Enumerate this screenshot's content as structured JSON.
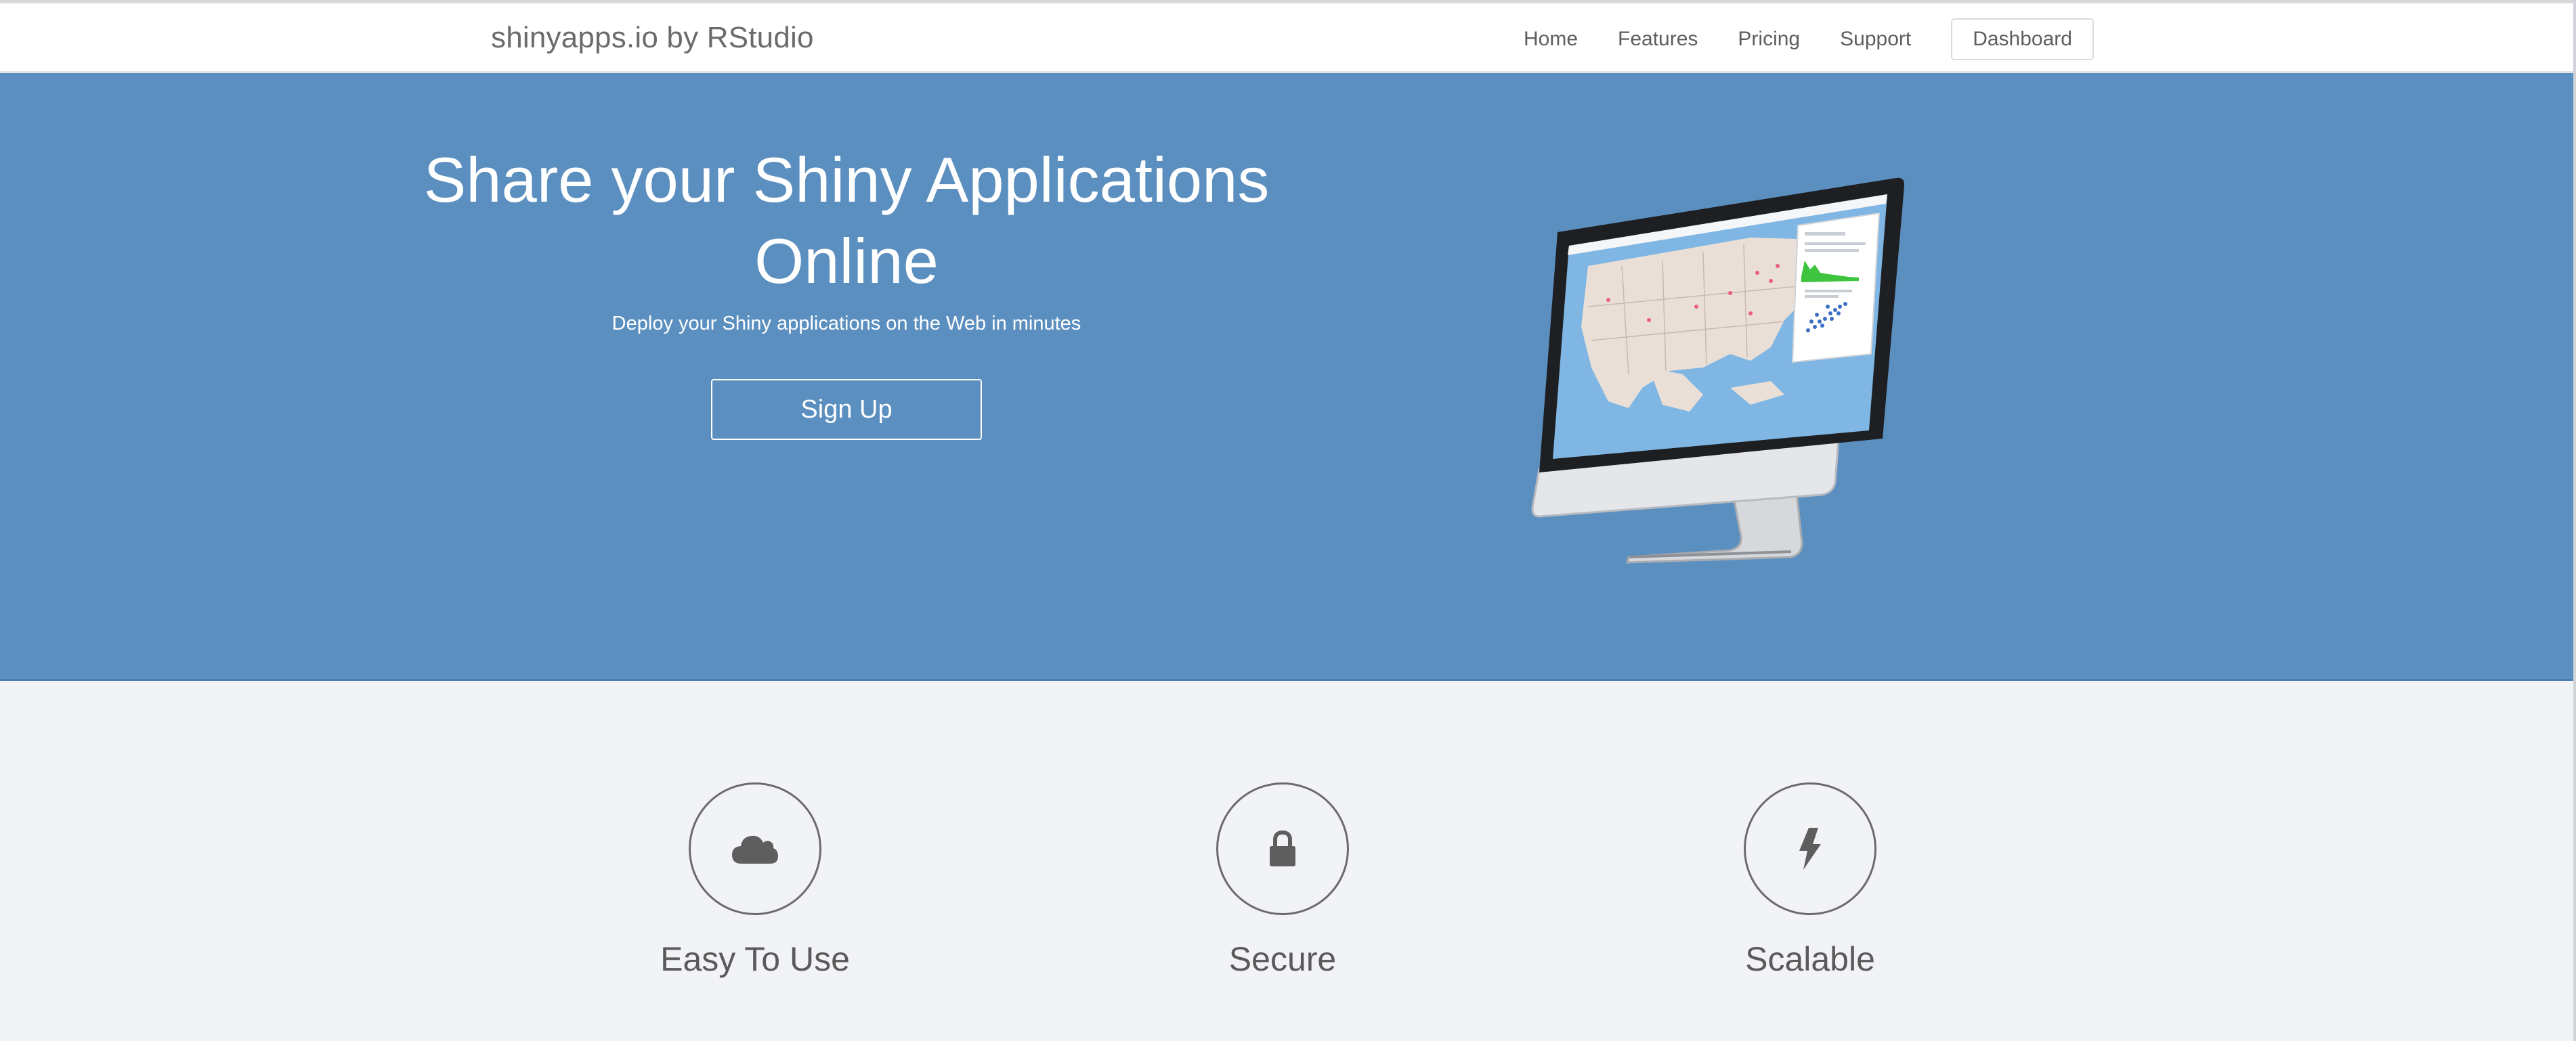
{
  "navbar": {
    "brand": "shinyapps.io by RStudio",
    "links": [
      "Home",
      "Features",
      "Pricing",
      "Support"
    ],
    "dashboard": "Dashboard"
  },
  "hero": {
    "title": "Share your Shiny Applications Online",
    "subtitle": "Deploy your Shiny applications on the Web in minutes",
    "signup": "Sign Up",
    "background_color": "#5b8fbf"
  },
  "features": [
    {
      "icon": "cloud-icon",
      "label": "Easy To Use"
    },
    {
      "icon": "lock-icon",
      "label": "Secure"
    },
    {
      "icon": "lightning-icon",
      "label": "Scalable"
    }
  ],
  "colors": {
    "hero": "#5b8fbf",
    "page_background": "#f2f3f6",
    "icon_gray": "#5e5e5e"
  }
}
